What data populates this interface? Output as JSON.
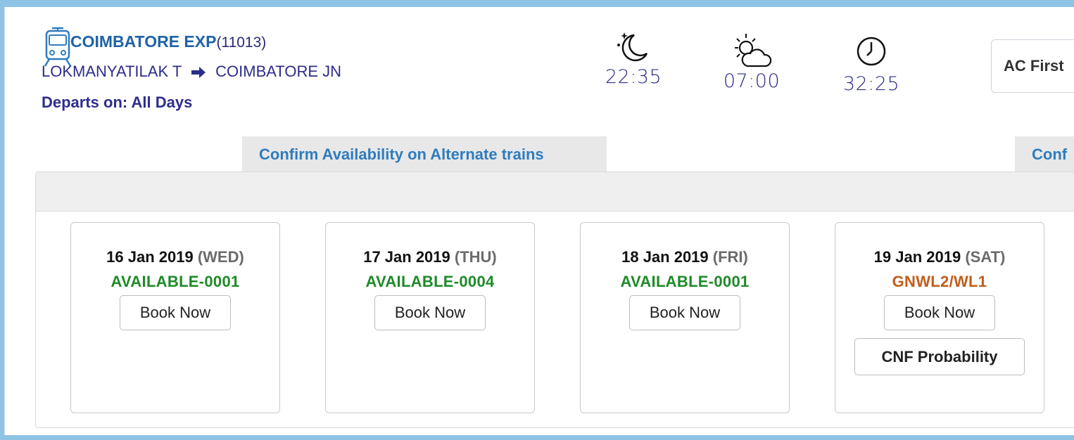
{
  "train": {
    "name": "COIMBATORE EXP",
    "number": "(11013)",
    "from": "LOKMANYATILAK T",
    "to": "COIMBATORE JN",
    "departs": "Departs on: All Days"
  },
  "timings": {
    "departure": "22:35",
    "arrival": "07:00",
    "duration": "32:25"
  },
  "class_select": {
    "value": "AC First"
  },
  "tabs": {
    "alternate": "Confirm Availability on Alternate trains",
    "second": "Conf"
  },
  "availability": [
    {
      "date": "16 Jan 2019",
      "day": "(WED)",
      "status": "AVAILABLE-0001",
      "book": "Book Now"
    },
    {
      "date": "17 Jan 2019",
      "day": "(THU)",
      "status": "AVAILABLE-0004",
      "book": "Book Now"
    },
    {
      "date": "18 Jan 2019",
      "day": "(FRI)",
      "status": "AVAILABLE-0001",
      "book": "Book Now"
    },
    {
      "date": "19 Jan 2019",
      "day": "(SAT)",
      "status": "GNWL2/WL1",
      "book": "Book Now",
      "cnf": "CNF Probability"
    }
  ],
  "colors": {
    "available": "#1e8a28",
    "waitlist": "#c35d1a",
    "train_name": "#1f63a8",
    "tab_text": "#2f7cbd"
  },
  "icons": {
    "train": "train-icon",
    "departure": "moon-stars-icon",
    "arrival": "sun-cloud-icon",
    "duration": "clock-icon",
    "route_arrow": "right-arrow-icon"
  }
}
